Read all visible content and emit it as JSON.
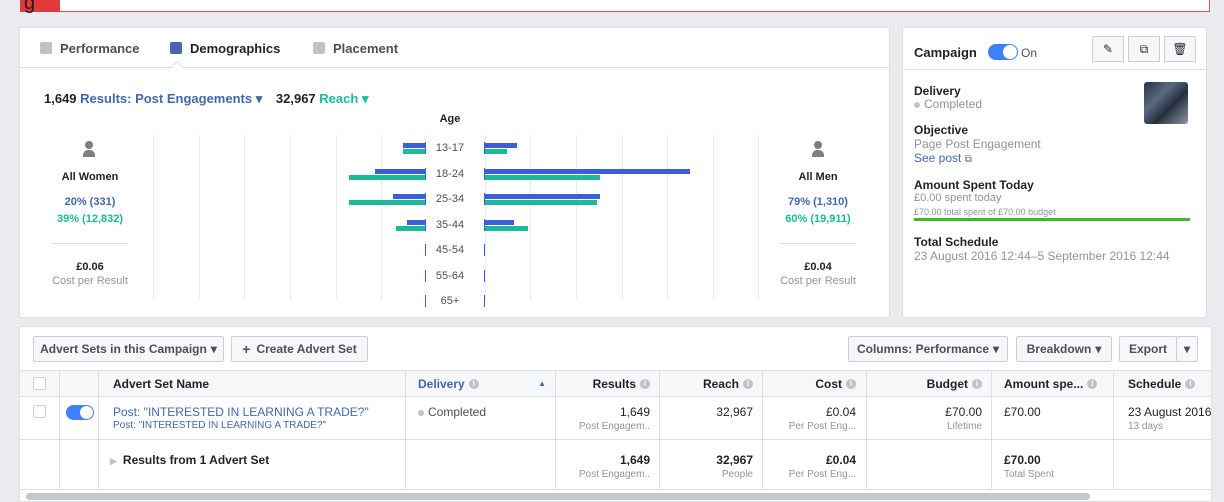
{
  "top_fragment": {
    "text": "g"
  },
  "tabs": [
    {
      "label": "Performance",
      "icon": "bar-chart-icon"
    },
    {
      "label": "Demographics",
      "icon": "people-icon"
    },
    {
      "label": "Placement",
      "icon": "placement-icon"
    }
  ],
  "summary": {
    "results_count": "1,649",
    "results_label": "Results: Post Engagements",
    "reach_count": "32,967",
    "reach_label": "Reach"
  },
  "age_chart": {
    "title": "Age",
    "women": {
      "label": "All Women",
      "results": "20% (331)",
      "reach": "39% (12,832)",
      "cost": "£0.06",
      "cost_label": "Cost per Result"
    },
    "men": {
      "label": "All Men",
      "results": "79% (1,310)",
      "reach": "60% (19,911)",
      "cost": "£0.04",
      "cost_label": "Cost per Result"
    }
  },
  "chart_data": {
    "type": "bar",
    "categories": [
      "13-17",
      "18-24",
      "25-34",
      "35-44",
      "45-54",
      "55-64",
      "65+"
    ],
    "series": [
      {
        "name": "Women Results",
        "side": "women",
        "metric": "results",
        "values": [
          6,
          14,
          9,
          5,
          0,
          0,
          0
        ]
      },
      {
        "name": "Women Reach",
        "side": "women",
        "metric": "reach",
        "values": [
          6,
          21,
          21,
          8,
          0,
          0,
          0
        ]
      },
      {
        "name": "Men Results",
        "side": "men",
        "metric": "results",
        "values": [
          9,
          57,
          32,
          8,
          0,
          0,
          0
        ]
      },
      {
        "name": "Men Reach",
        "side": "men",
        "metric": "reach",
        "values": [
          6,
          32,
          31,
          12,
          0,
          0,
          0
        ]
      }
    ],
    "title": "Age",
    "colors": {
      "results": "#3b5fd8",
      "reach": "#1cb99d"
    }
  },
  "campaign": {
    "label": "Campaign",
    "toggle_state": "On",
    "delivery_label": "Delivery",
    "delivery_value": "Completed",
    "objective_label": "Objective",
    "objective_value": "Page Post Engagement",
    "see_post": "See post",
    "spent_label": "Amount Spent Today",
    "spent_today": "£0.00 spent today",
    "spent_total": "£70.00 total spent of £70.00 budget",
    "spent_fraction": 1.0,
    "schedule_label": "Total Schedule",
    "schedule_value": "23 August 2016 12:44–5 September 2016 12:44"
  },
  "toolbar": {
    "advert_sets": "Advert Sets in this Campaign",
    "create": "Create Advert Set",
    "columns": "Columns: Performance",
    "breakdown": "Breakdown",
    "export": "Export"
  },
  "table": {
    "headers": {
      "name": "Advert Set Name",
      "delivery": "Delivery",
      "results": "Results",
      "reach": "Reach",
      "cost": "Cost",
      "budget": "Budget",
      "amount": "Amount spe...",
      "schedule": "Schedule"
    },
    "row": {
      "name": "Post: \"INTERESTED IN LEARNING A TRADE?\"",
      "sub": "Post: \"INTERESTED IN LEARNING A TRADE?\"",
      "delivery": "Completed",
      "results": "1,649",
      "results_sub": "Post Engagem..",
      "reach": "32,967",
      "cost": "£0.04",
      "cost_sub": "Per Post Eng...",
      "budget": "£70.00",
      "budget_sub": "Lifetime",
      "amount": "£70.00",
      "schedule": "23 August 2016",
      "schedule_sub": "13 days"
    },
    "total": {
      "label": "Results from 1 Advert Set",
      "results": "1,649",
      "results_sub": "Post Engagem..",
      "reach": "32,967",
      "reach_sub": "People",
      "cost": "£0.04",
      "cost_sub": "Per Post Eng...",
      "amount": "£70.00",
      "amount_sub": "Total Spent"
    }
  }
}
